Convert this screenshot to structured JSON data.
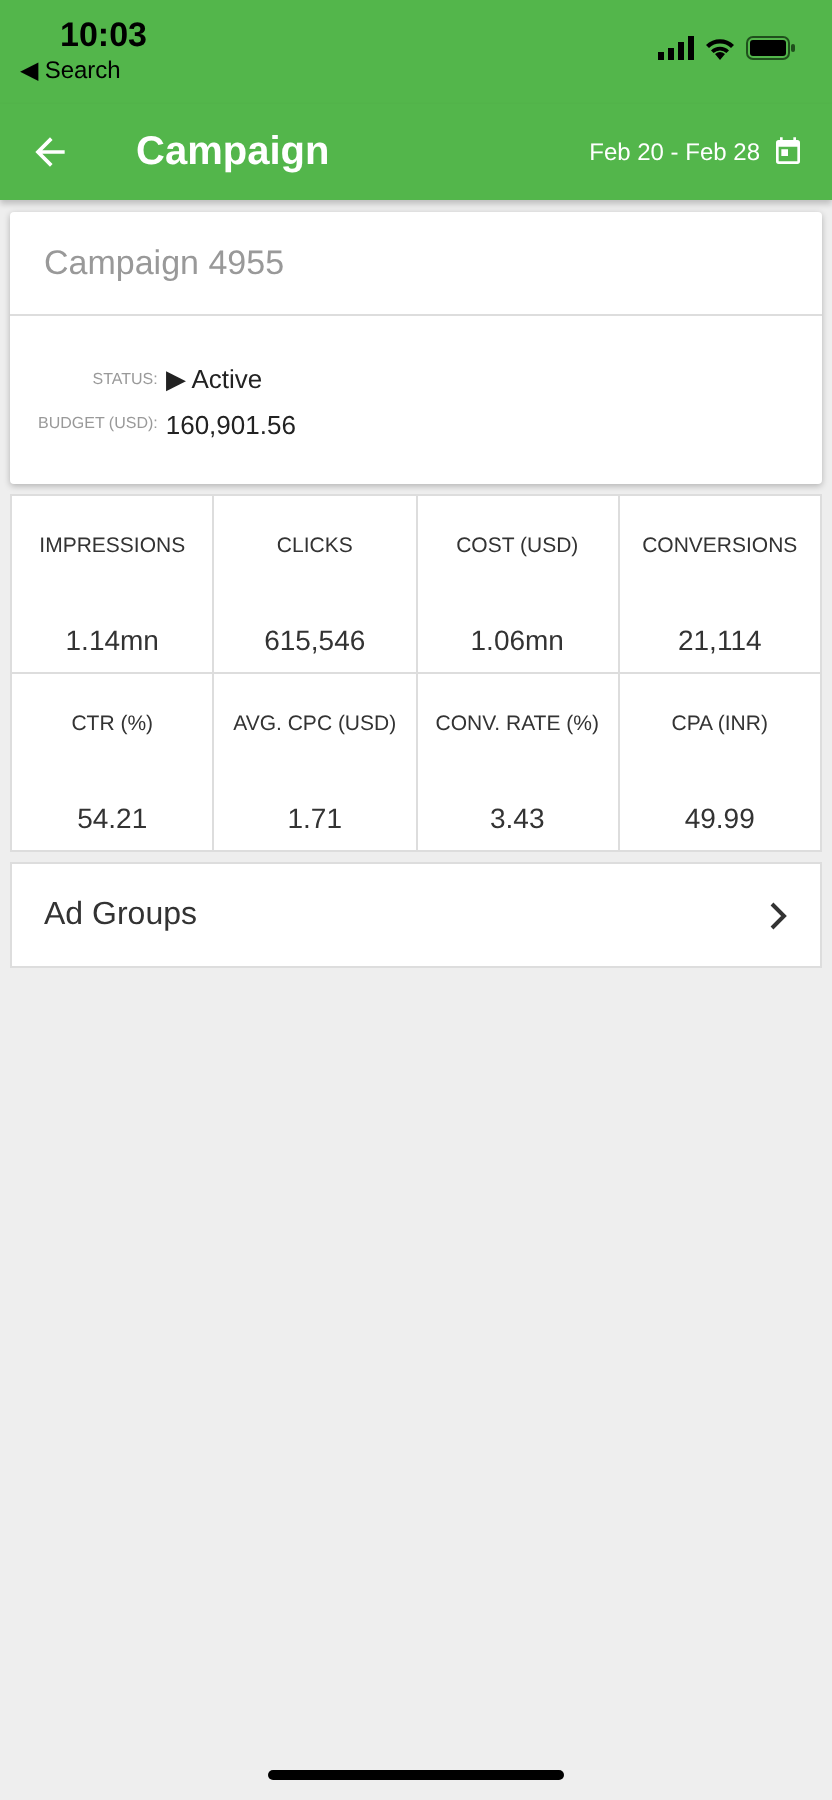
{
  "status_bar": {
    "time": "10:03",
    "back_label": "◀ Search"
  },
  "header": {
    "title": "Campaign",
    "date_range": "Feb 20 - Feb 28"
  },
  "campaign": {
    "name": "Campaign 4955",
    "fields": [
      {
        "label": "STATUS:",
        "value": "▶ Active"
      },
      {
        "label": "BUDGET (USD):",
        "value": "160,901.56"
      }
    ]
  },
  "metrics": [
    {
      "label": "IMPRESSIONS",
      "value": "1.14mn"
    },
    {
      "label": "CLICKS",
      "value": "615,546"
    },
    {
      "label": "COST (USD)",
      "value": "1.06mn"
    },
    {
      "label": "CONVERSIONS",
      "value": "21,114"
    },
    {
      "label": "CTR (%)",
      "value": "54.21"
    },
    {
      "label": "AVG. CPC (USD)",
      "value": "1.71"
    },
    {
      "label": "CONV. RATE (%)",
      "value": "3.43"
    },
    {
      "label": "CPA (INR)",
      "value": "49.99"
    }
  ],
  "links": [
    {
      "label": "Ad Groups"
    }
  ]
}
